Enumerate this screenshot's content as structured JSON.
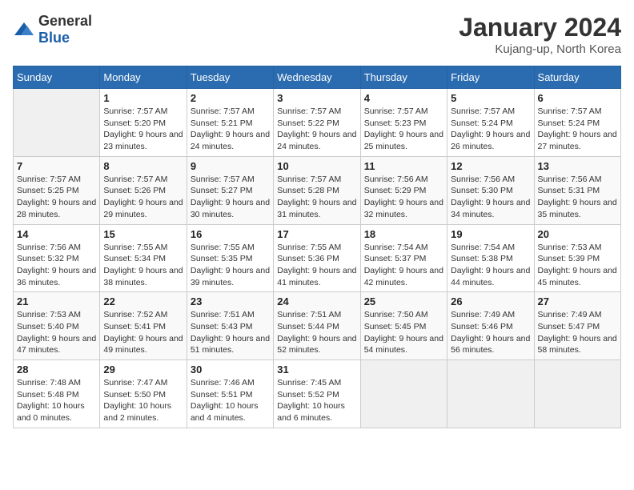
{
  "logo": {
    "general": "General",
    "blue": "Blue"
  },
  "title": "January 2024",
  "location": "Kujang-up, North Korea",
  "weekdays": [
    "Sunday",
    "Monday",
    "Tuesday",
    "Wednesday",
    "Thursday",
    "Friday",
    "Saturday"
  ],
  "weeks": [
    [
      {
        "day": "",
        "empty": true
      },
      {
        "day": "1",
        "sunrise": "7:57 AM",
        "sunset": "5:20 PM",
        "daylight": "9 hours and 23 minutes."
      },
      {
        "day": "2",
        "sunrise": "7:57 AM",
        "sunset": "5:21 PM",
        "daylight": "9 hours and 24 minutes."
      },
      {
        "day": "3",
        "sunrise": "7:57 AM",
        "sunset": "5:22 PM",
        "daylight": "9 hours and 24 minutes."
      },
      {
        "day": "4",
        "sunrise": "7:57 AM",
        "sunset": "5:23 PM",
        "daylight": "9 hours and 25 minutes."
      },
      {
        "day": "5",
        "sunrise": "7:57 AM",
        "sunset": "5:24 PM",
        "daylight": "9 hours and 26 minutes."
      },
      {
        "day": "6",
        "sunrise": "7:57 AM",
        "sunset": "5:24 PM",
        "daylight": "9 hours and 27 minutes."
      }
    ],
    [
      {
        "day": "7",
        "sunrise": "7:57 AM",
        "sunset": "5:25 PM",
        "daylight": "9 hours and 28 minutes."
      },
      {
        "day": "8",
        "sunrise": "7:57 AM",
        "sunset": "5:26 PM",
        "daylight": "9 hours and 29 minutes."
      },
      {
        "day": "9",
        "sunrise": "7:57 AM",
        "sunset": "5:27 PM",
        "daylight": "9 hours and 30 minutes."
      },
      {
        "day": "10",
        "sunrise": "7:57 AM",
        "sunset": "5:28 PM",
        "daylight": "9 hours and 31 minutes."
      },
      {
        "day": "11",
        "sunrise": "7:56 AM",
        "sunset": "5:29 PM",
        "daylight": "9 hours and 32 minutes."
      },
      {
        "day": "12",
        "sunrise": "7:56 AM",
        "sunset": "5:30 PM",
        "daylight": "9 hours and 34 minutes."
      },
      {
        "day": "13",
        "sunrise": "7:56 AM",
        "sunset": "5:31 PM",
        "daylight": "9 hours and 35 minutes."
      }
    ],
    [
      {
        "day": "14",
        "sunrise": "7:56 AM",
        "sunset": "5:32 PM",
        "daylight": "9 hours and 36 minutes."
      },
      {
        "day": "15",
        "sunrise": "7:55 AM",
        "sunset": "5:34 PM",
        "daylight": "9 hours and 38 minutes."
      },
      {
        "day": "16",
        "sunrise": "7:55 AM",
        "sunset": "5:35 PM",
        "daylight": "9 hours and 39 minutes."
      },
      {
        "day": "17",
        "sunrise": "7:55 AM",
        "sunset": "5:36 PM",
        "daylight": "9 hours and 41 minutes."
      },
      {
        "day": "18",
        "sunrise": "7:54 AM",
        "sunset": "5:37 PM",
        "daylight": "9 hours and 42 minutes."
      },
      {
        "day": "19",
        "sunrise": "7:54 AM",
        "sunset": "5:38 PM",
        "daylight": "9 hours and 44 minutes."
      },
      {
        "day": "20",
        "sunrise": "7:53 AM",
        "sunset": "5:39 PM",
        "daylight": "9 hours and 45 minutes."
      }
    ],
    [
      {
        "day": "21",
        "sunrise": "7:53 AM",
        "sunset": "5:40 PM",
        "daylight": "9 hours and 47 minutes."
      },
      {
        "day": "22",
        "sunrise": "7:52 AM",
        "sunset": "5:41 PM",
        "daylight": "9 hours and 49 minutes."
      },
      {
        "day": "23",
        "sunrise": "7:51 AM",
        "sunset": "5:43 PM",
        "daylight": "9 hours and 51 minutes."
      },
      {
        "day": "24",
        "sunrise": "7:51 AM",
        "sunset": "5:44 PM",
        "daylight": "9 hours and 52 minutes."
      },
      {
        "day": "25",
        "sunrise": "7:50 AM",
        "sunset": "5:45 PM",
        "daylight": "9 hours and 54 minutes."
      },
      {
        "day": "26",
        "sunrise": "7:49 AM",
        "sunset": "5:46 PM",
        "daylight": "9 hours and 56 minutes."
      },
      {
        "day": "27",
        "sunrise": "7:49 AM",
        "sunset": "5:47 PM",
        "daylight": "9 hours and 58 minutes."
      }
    ],
    [
      {
        "day": "28",
        "sunrise": "7:48 AM",
        "sunset": "5:48 PM",
        "daylight": "10 hours and 0 minutes."
      },
      {
        "day": "29",
        "sunrise": "7:47 AM",
        "sunset": "5:50 PM",
        "daylight": "10 hours and 2 minutes."
      },
      {
        "day": "30",
        "sunrise": "7:46 AM",
        "sunset": "5:51 PM",
        "daylight": "10 hours and 4 minutes."
      },
      {
        "day": "31",
        "sunrise": "7:45 AM",
        "sunset": "5:52 PM",
        "daylight": "10 hours and 6 minutes."
      },
      {
        "day": "",
        "empty": true
      },
      {
        "day": "",
        "empty": true
      },
      {
        "day": "",
        "empty": true
      }
    ]
  ],
  "labels": {
    "sunrise": "Sunrise:",
    "sunset": "Sunset:",
    "daylight": "Daylight:"
  }
}
